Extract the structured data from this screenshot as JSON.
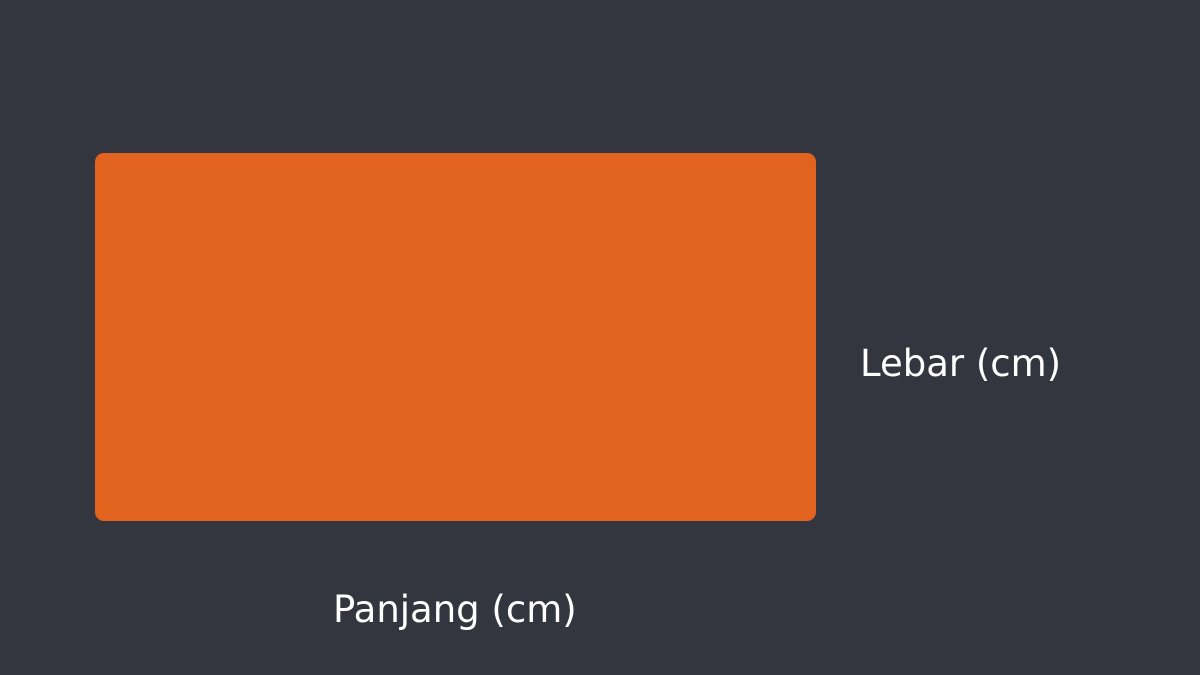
{
  "diagram": {
    "shape": "rectangle",
    "labels": {
      "width": "Lebar (cm)",
      "length": "Panjang (cm)"
    }
  },
  "colors": {
    "background": "#33363e",
    "rectangle_fill": "#e2631d",
    "label_text": "#ffffff"
  }
}
